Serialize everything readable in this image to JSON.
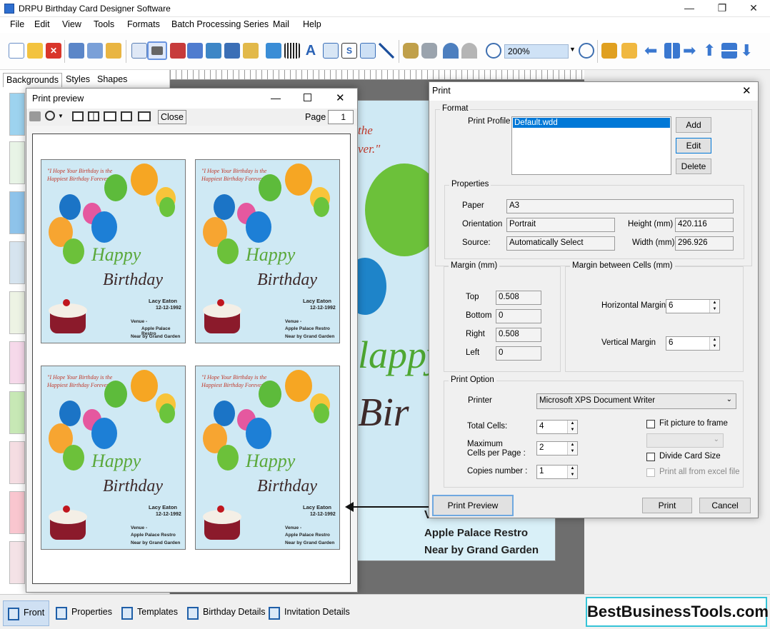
{
  "app": {
    "title": "DRPU Birthday Card Designer Software"
  },
  "menu": [
    "File",
    "Edit",
    "View",
    "Tools",
    "Formats",
    "Batch Processing Series",
    "Mail",
    "Help"
  ],
  "toolbar": {
    "zoom": "200%"
  },
  "left_tabs": [
    "Backgrounds",
    "Styles",
    "Shapes"
  ],
  "card": {
    "quote_line1": "\"I Hope Your Birthday is the",
    "quote_line2": "Happiest Birthday Forever.\"",
    "quote_partial1": "the",
    "quote_partial2": "ver.\"",
    "happy": "Happy",
    "birthday": "Birthday",
    "partial_happy": "lappy",
    "partial_birthday": "Bir",
    "name": "Lacy Eaton",
    "date": "12-12-1992",
    "venue1": "Venue -",
    "venue2": "Apple Palace Restro",
    "venue3": "Near by Grand Garden",
    "venue_partial": "V"
  },
  "print_preview": {
    "title": "Print preview",
    "close": "Close",
    "page_label": "Page",
    "page_value": "1"
  },
  "print_dialog": {
    "title": "Print",
    "format_label": "Format",
    "print_profile_label": "Print Profile",
    "profile_selected": "Default.wdd",
    "add": "Add",
    "edit": "Edit",
    "delete": "Delete",
    "properties_label": "Properties",
    "paper_label": "Paper",
    "paper": "A3",
    "orientation_label": "Orientation",
    "orientation": "Portrait",
    "source_label": "Source:",
    "source": "Automatically Select",
    "height_label": "Height (mm)",
    "height": "420.116",
    "width_label": "Width (mm)",
    "width": "296.926",
    "margin_label": "Margin (mm)",
    "top_label": "Top",
    "top": "0.508",
    "bottom_label": "Bottom",
    "bottom": "0",
    "right_label": "Right",
    "right": "0.508",
    "left_label": "Left",
    "left": "0",
    "cell_margin_label": "Margin between Cells (mm)",
    "hmargin_label": "Horizontal Margin",
    "hmargin": "6",
    "vmargin_label": "Vertical Margin",
    "vmargin": "6",
    "print_option_label": "Print Option",
    "printer_label": "Printer",
    "printer": "Microsoft XPS Document Writer",
    "total_cells_label": "Total Cells:",
    "total_cells": "4",
    "max_cells_label1": "Maximum",
    "max_cells_label2": "Cells per Page :",
    "max_cells": "2",
    "copies_label": "Copies number :",
    "copies": "1",
    "fit_picture": "Fit picture to frame",
    "divide_card": "Divide Card Size",
    "print_all_excel": "Print all from excel file",
    "print_preview_btn": "Print Preview",
    "print_btn": "Print",
    "cancel_btn": "Cancel"
  },
  "bottom_tabs": [
    "Front",
    "Properties",
    "Templates",
    "Birthday Details",
    "Invitation Details"
  ],
  "brand": "BestBusinessTools.com"
}
